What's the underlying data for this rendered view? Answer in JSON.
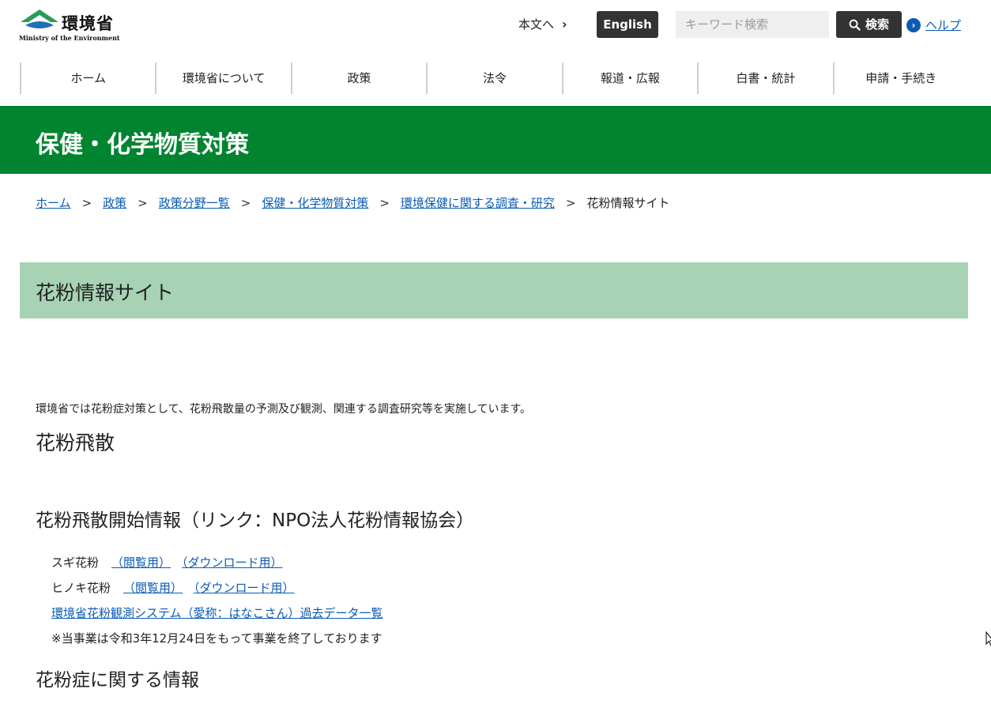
{
  "header": {
    "logo_ja": "環境省",
    "logo_en": "Ministry of the Environment",
    "skip_link": "本文へ",
    "english_label": "English",
    "search_placeholder": "キーワード検索",
    "search_button": "検索",
    "help_link": "ヘルプ"
  },
  "nav": {
    "items": [
      "ホーム",
      "環境省について",
      "政策",
      "法令",
      "報道・広報",
      "白書・統計",
      "申請・手続き"
    ]
  },
  "section": {
    "title": "保健・化学物質対策"
  },
  "breadcrumb": {
    "items": [
      "ホーム",
      "政策",
      "政策分野一覧",
      "保健・化学物質対策",
      "環境保健に関する調査・研究"
    ],
    "current": "花粉情報サイト",
    "separator": ">"
  },
  "page": {
    "title": "花粉情報サイト",
    "intro": "環境省では花粉症対策として、花粉飛散量の予測及び観測、関連する調査研究等を実施しています。",
    "h_pollen": "花粉飛散",
    "h_start": "花粉飛散開始情報（リンク：NPO法人花粉情報協会）",
    "sugi_label": "スギ花粉",
    "hinoki_label": "ヒノキ花粉",
    "view_link": "（閲覧用）",
    "download_link": "（ダウンロード用）",
    "hanakosan_link": "環境省花粉観測システム（愛称：はなこさん）過去データ一覧",
    "notice": "※当事業は令和3年12月24日をもって事業を終了しております",
    "h_info": "花粉症に関する情報"
  },
  "colors": {
    "brand_green": "#00842f",
    "heading_bg": "#a7d2b4",
    "link": "#0b5bb5",
    "dark_button": "#333333"
  }
}
